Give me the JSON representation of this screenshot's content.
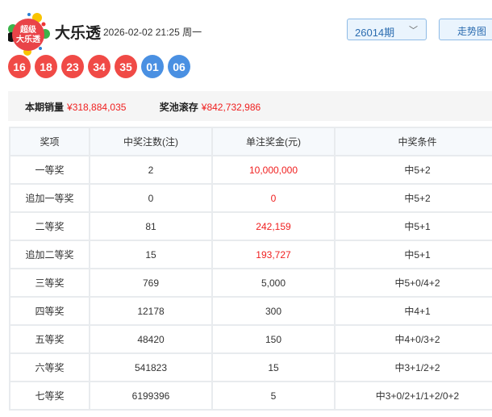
{
  "header": {
    "logo_text": "超级大乐透",
    "title": "大乐透",
    "datetime": "2026-02-02 21:25 周一",
    "issue_select": "26014期",
    "trend_button": "走势图"
  },
  "balls": {
    "red": [
      "16",
      "18",
      "23",
      "34",
      "35"
    ],
    "blue": [
      "01",
      "06"
    ],
    "colors": {
      "red": "#f04a46",
      "blue": "#4a90e2"
    }
  },
  "stats": {
    "sales_label": "本期销量",
    "sales_value": "¥318,884,035",
    "pool_label": "奖池滚存",
    "pool_value": "¥842,732,986"
  },
  "table": {
    "headers": [
      "奖项",
      "中奖注数(注)",
      "单注奖金(元)",
      "中奖条件"
    ],
    "rows": [
      [
        "一等奖",
        "2",
        "10,000,000",
        "中5+2"
      ],
      [
        "追加一等奖",
        "0",
        "0",
        "中5+2"
      ],
      [
        "二等奖",
        "81",
        "242,159",
        "中5+1"
      ],
      [
        "追加二等奖",
        "15",
        "193,727",
        "中5+1"
      ],
      [
        "三等奖",
        "769",
        "5,000",
        "中5+0/4+2"
      ],
      [
        "四等奖",
        "12178",
        "300",
        "中4+1"
      ],
      [
        "五等奖",
        "48420",
        "150",
        "中4+0/3+2"
      ],
      [
        "六等奖",
        "541823",
        "15",
        "中3+1/2+2"
      ],
      [
        "七等奖",
        "6199396",
        "5",
        "中3+0/2+1/1+2/0+2"
      ]
    ],
    "highlight_rows": 4
  }
}
